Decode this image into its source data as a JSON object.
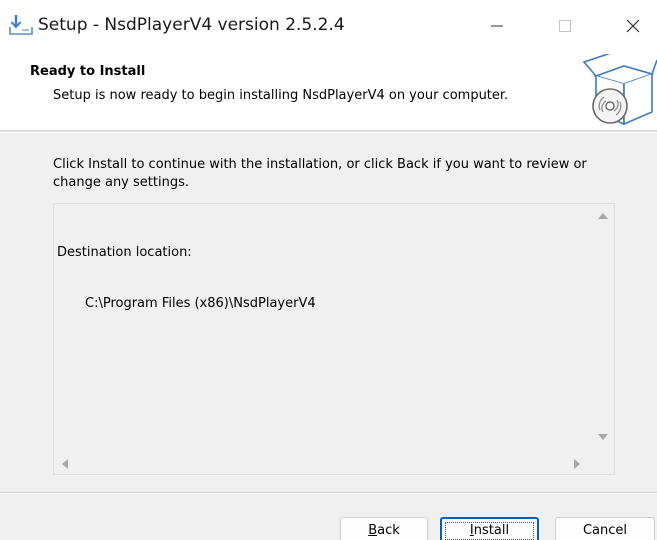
{
  "window": {
    "title": "Setup - NsdPlayerV4 version 2.5.2.4",
    "icon": "setup-download-icon",
    "controls": [
      "minimize-icon",
      "maximize-icon",
      "close-icon"
    ]
  },
  "header": {
    "title": "Ready to Install",
    "subtitle": "Setup is now ready to begin installing NsdPlayerV4 on your computer.",
    "graphic": "box-disc-icon"
  },
  "body": {
    "instruction": "Click Install to continue with the installation, or click Back if you want to review or change any settings.",
    "memo": {
      "line1": "Destination location:",
      "line2": "C:\\Program Files (x86)\\NsdPlayerV4"
    }
  },
  "buttons": {
    "back": {
      "mnemonic": "B",
      "rest": "ack"
    },
    "install": {
      "mnemonic": "I",
      "rest": "nstall"
    },
    "cancel": "Cancel"
  },
  "colors": {
    "accent": "#005fb8",
    "background": "#f0f0f0",
    "header_background": "#ffffff"
  }
}
